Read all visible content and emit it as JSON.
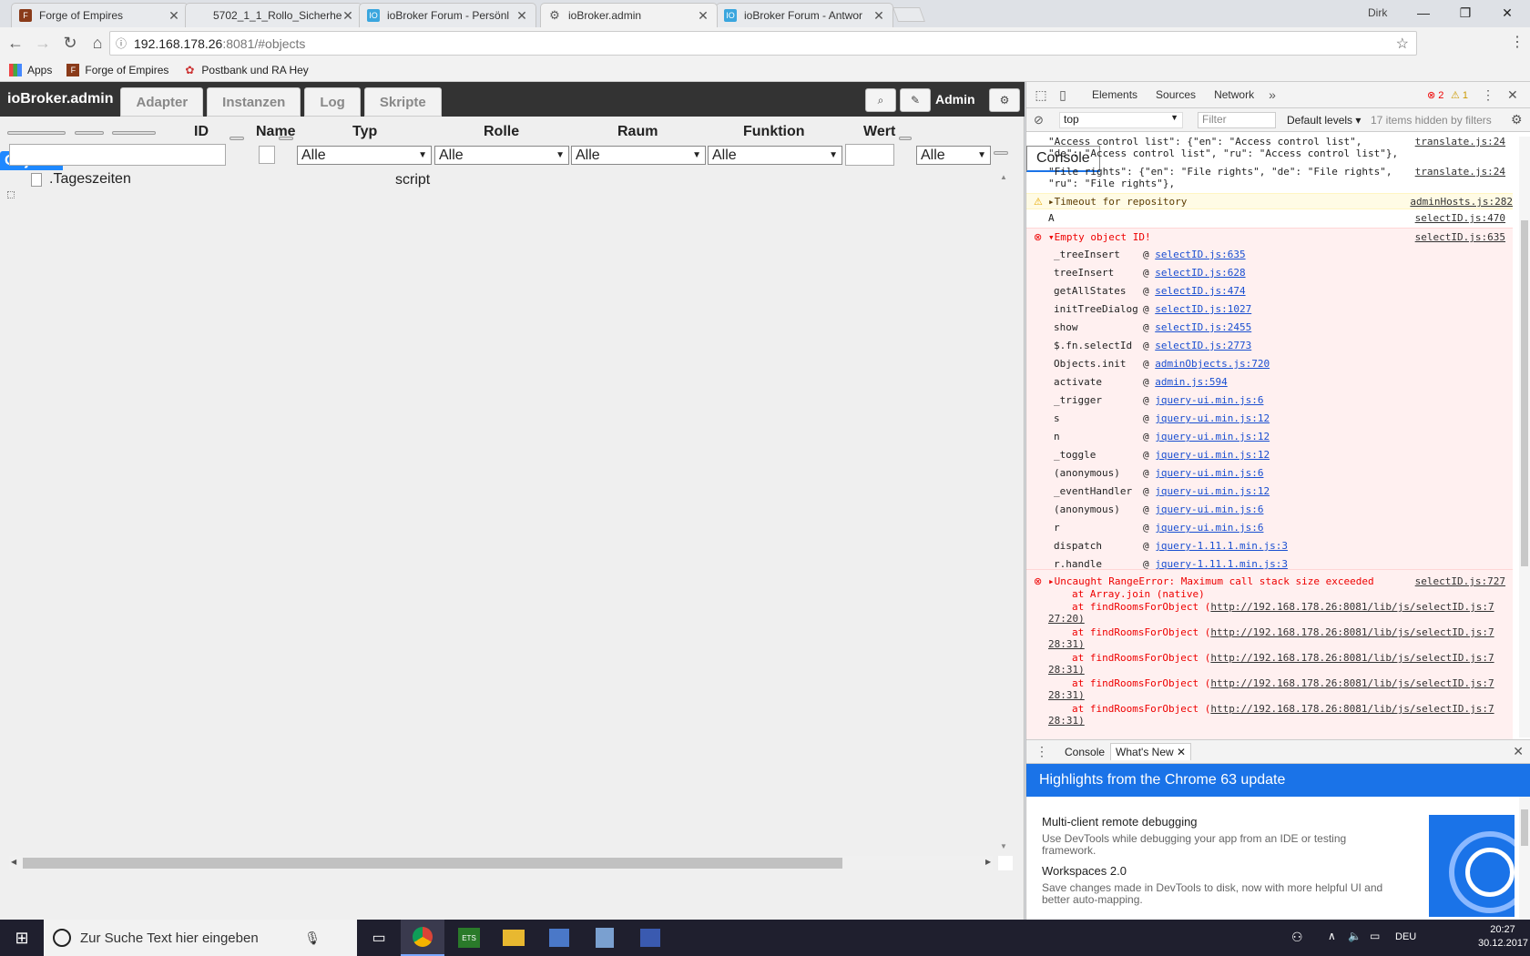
{
  "browser": {
    "tabs": [
      {
        "title": "Forge of Empires",
        "icon": "foe-icon",
        "active": false
      },
      {
        "title": "5702_1_1_Rollo_Sicherhe",
        "icon": "doc-icon",
        "active": false
      },
      {
        "title": "ioBroker Forum - Persönl",
        "icon": "iobroker-icon",
        "active": false
      },
      {
        "title": "ioBroker.admin",
        "icon": "gear-icon",
        "active": true
      },
      {
        "title": "ioBroker Forum - Antwor",
        "icon": "iobroker-icon",
        "active": false
      }
    ],
    "profile_user": "Dirk",
    "url_host": "192.168.178.26",
    "url_path": ":8081/#objects",
    "bookmarks": [
      {
        "label": "Apps",
        "icon": "apps-grid-icon"
      },
      {
        "label": "Forge of Empires",
        "icon": "foe-icon"
      },
      {
        "label": "Postbank und RA Hey",
        "icon": "postbank-icon"
      }
    ]
  },
  "app": {
    "title": "ioBroker.admin",
    "nav_tabs": [
      "Adapter",
      "Instanzen",
      "Objekte",
      "Log",
      "Skripte"
    ],
    "selected_tab": "Objekte",
    "user_label": "Admin",
    "columns": {
      "id": "ID",
      "name": "Name",
      "typ": "Typ",
      "rolle": "Rolle",
      "raum": "Raum",
      "funktion": "Funktion",
      "wert": "Wert"
    },
    "filters": {
      "typ": "Alle",
      "rolle": "Alle",
      "raum": "Alle",
      "funktion": "Alle",
      "last": "Alle"
    },
    "rows": [
      {
        "id": ".Tageszeiten",
        "typ": "script"
      }
    ]
  },
  "devtools": {
    "tabs": [
      "Elements",
      "Console",
      "Sources",
      "Network"
    ],
    "selected_tab": "Console",
    "error_count": "2",
    "warning_count": "1",
    "context": "top",
    "filter_placeholder": "Filter",
    "levels": "Default levels",
    "hidden": "17 items hidden by filters",
    "logs": {
      "l1_a": "\"Access control list\": {\"en\": \"Access control list\",",
      "l1_b": "\"de\": \"Access control list\", \"ru\": \"Access control list\"},",
      "l1_src": "translate.js:24",
      "l2_a": "\"File rights\": {\"en\": \"File rights\", \"de\": \"File rights\",",
      "l2_b": "\"ru\": \"File rights\"},",
      "l2_src": "translate.js:24",
      "warn": "Timeout for repository",
      "warn_src": "adminHosts.js:282",
      "a": "A",
      "a_src": "selectID.js:470",
      "err1": "Empty object ID!",
      "err1_src": "selectID.js:635",
      "stack": [
        {
          "fn": "_treeInsert",
          "link": "selectID.js:635"
        },
        {
          "fn": "treeInsert",
          "link": "selectID.js:628"
        },
        {
          "fn": "getAllStates",
          "link": "selectID.js:474"
        },
        {
          "fn": "initTreeDialog",
          "link": "selectID.js:1027"
        },
        {
          "fn": "show",
          "link": "selectID.js:2455"
        },
        {
          "fn": "$.fn.selectId",
          "link": "selectID.js:2773"
        },
        {
          "fn": "Objects.init",
          "link": "adminObjects.js:720"
        },
        {
          "fn": "activate",
          "link": "admin.js:594"
        },
        {
          "fn": "_trigger",
          "link": "jquery-ui.min.js:6"
        },
        {
          "fn": "s",
          "link": "jquery-ui.min.js:12"
        },
        {
          "fn": "n",
          "link": "jquery-ui.min.js:12"
        },
        {
          "fn": "_toggle",
          "link": "jquery-ui.min.js:12"
        },
        {
          "fn": "(anonymous)",
          "link": "jquery-ui.min.js:6"
        },
        {
          "fn": "_eventHandler",
          "link": "jquery-ui.min.js:12"
        },
        {
          "fn": "(anonymous)",
          "link": "jquery-ui.min.js:6"
        },
        {
          "fn": "r",
          "link": "jquery-ui.min.js:6"
        },
        {
          "fn": "dispatch",
          "link": "jquery-1.11.1.min.js:3"
        },
        {
          "fn": "r.handle",
          "link": "jquery-1.11.1.min.js:3"
        }
      ],
      "err2": "Uncaught RangeError: Maximum call stack size exceeded",
      "err2_src": "selectID.js:727",
      "err2_join": "at Array.join (native)",
      "err2_at": "at findRoomsForObject (",
      "err2_url": "http://192.168.178.26:8081/lib/js/selectID.js:7",
      "err2_tails": [
        "27:20)",
        "28:31)",
        "28:31)",
        "28:31)",
        "28:31)"
      ]
    },
    "drawer": {
      "tabs": [
        "Console",
        "What's New"
      ],
      "selected": "What's New",
      "highlight": "Highlights from the Chrome 63 update",
      "features": [
        {
          "title": "Multi-client remote debugging",
          "desc": "Use DevTools while debugging your app from an IDE or testing framework."
        },
        {
          "title": "Workspaces 2.0",
          "desc": "Save changes made in DevTools to disk, now with more helpful UI and better auto-mapping."
        }
      ]
    }
  },
  "taskbar": {
    "search_placeholder": "Zur Suche Text hier eingeben",
    "lang": "DEU",
    "time": "20:27",
    "date": "30.12.2017"
  },
  "colors": {
    "accent": "#1e88ff",
    "appbar": "#333333",
    "error": "#e00000",
    "devtools_blue": "#1a73e8"
  }
}
